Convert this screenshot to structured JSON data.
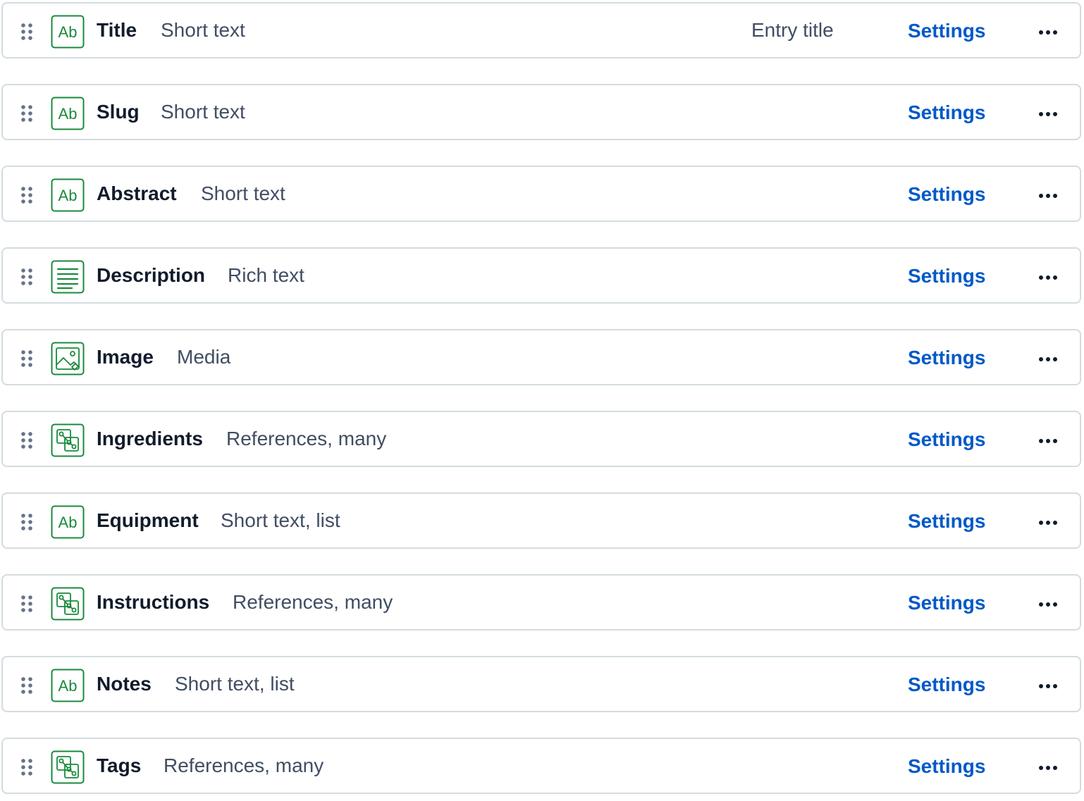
{
  "colors": {
    "icon_green": "#1a8a3c",
    "link_blue": "#0059c8",
    "border": "#d3dce0",
    "name_text": "#111b2b",
    "type_text": "#414d63"
  },
  "fields": [
    {
      "name": "Title",
      "type": "Short text",
      "icon": "text-ab-icon",
      "badge": "Entry title",
      "settings_label": "Settings"
    },
    {
      "name": "Slug",
      "type": "Short text",
      "icon": "text-ab-icon",
      "settings_label": "Settings"
    },
    {
      "name": "Abstract",
      "type": "Short text",
      "icon": "text-ab-icon",
      "settings_label": "Settings"
    },
    {
      "name": "Description",
      "type": "Rich text",
      "icon": "rich-text-icon",
      "settings_label": "Settings"
    },
    {
      "name": "Image",
      "type": "Media",
      "icon": "media-image-icon",
      "settings_label": "Settings"
    },
    {
      "name": "Ingredients",
      "type": "References, many",
      "icon": "references-icon",
      "settings_label": "Settings"
    },
    {
      "name": "Equipment",
      "type": "Short text, list",
      "icon": "text-ab-icon",
      "settings_label": "Settings"
    },
    {
      "name": "Instructions",
      "type": "References, many",
      "icon": "references-icon",
      "settings_label": "Settings"
    },
    {
      "name": "Notes",
      "type": "Short text, list",
      "icon": "text-ab-icon",
      "settings_label": "Settings"
    },
    {
      "name": "Tags",
      "type": "References, many",
      "icon": "references-icon",
      "settings_label": "Settings"
    }
  ]
}
